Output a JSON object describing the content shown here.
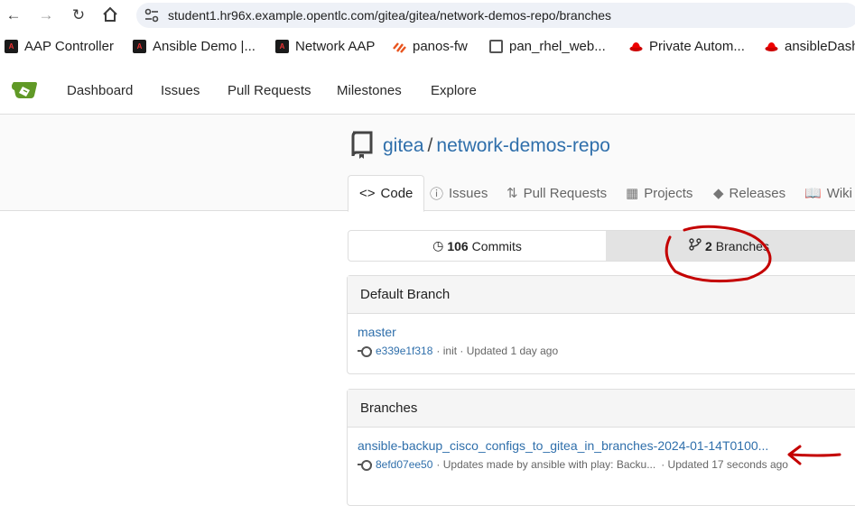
{
  "browser": {
    "url": "student1.hr96x.example.opentlc.com/gitea/gitea/network-demos-repo/branches",
    "bookmarks": [
      {
        "label": "AAP Controller",
        "icon": "ansible-icon"
      },
      {
        "label": "Ansible Demo |...",
        "icon": "ansible-icon"
      },
      {
        "label": "Network AAP",
        "icon": "ansible-icon"
      },
      {
        "label": "panos-fw",
        "icon": "paloalto-icon"
      },
      {
        "label": "pan_rhel_web...",
        "icon": "globe-icon"
      },
      {
        "label": "Private Autom...",
        "icon": "redhat-icon"
      },
      {
        "label": "ansibleDash",
        "icon": "redhat-icon"
      }
    ]
  },
  "nav": {
    "items": [
      "Dashboard",
      "Issues",
      "Pull Requests",
      "Milestones",
      "Explore"
    ]
  },
  "repo": {
    "owner": "gitea",
    "separator": "/",
    "name": "network-demos-repo",
    "tabs": [
      {
        "label": "Code",
        "icon": "code-icon"
      },
      {
        "label": "Issues",
        "icon": "issue-icon"
      },
      {
        "label": "Pull Requests",
        "icon": "pull-request-icon"
      },
      {
        "label": "Projects",
        "icon": "project-icon"
      },
      {
        "label": "Releases",
        "icon": "tag-icon"
      },
      {
        "label": "Wiki",
        "icon": "book-icon"
      }
    ]
  },
  "stats": {
    "commits_count": "106",
    "commits_label": "Commits",
    "branches_count": "2",
    "branches_label": "Branches"
  },
  "default_branch": {
    "heading": "Default Branch",
    "name": "master",
    "sha": "e339e1f318",
    "meta": "· init · Updated 1 day ago"
  },
  "branches": {
    "heading": "Branches",
    "items": [
      {
        "name": "ansible-backup_cisco_configs_to_gitea_in_branches-2024-01-14T0100...",
        "sha": "8efd07ee50",
        "message": "· Updates made by ansible with play: Backu...",
        "updated": "· Updated 17 seconds ago"
      }
    ]
  },
  "colors": {
    "link": "#2f6fab",
    "annotation": "#c40000",
    "gitea_green": "#609926"
  }
}
